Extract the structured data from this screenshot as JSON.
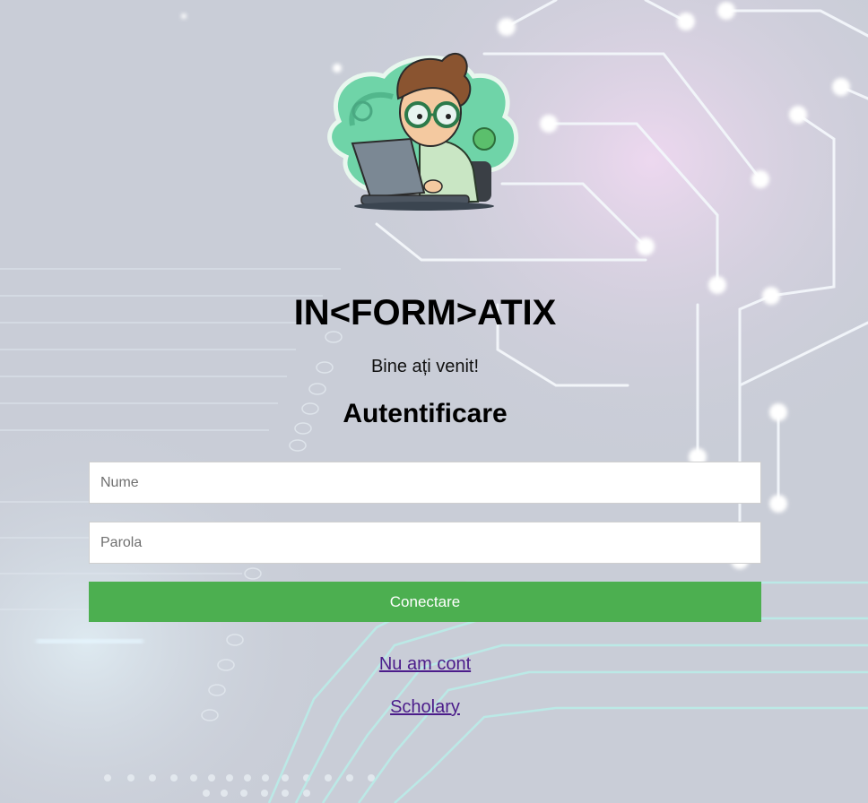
{
  "brand": {
    "title": "IN<FORM>ATIX",
    "welcome": "Bine ați venit!"
  },
  "login": {
    "heading": "Autentificare",
    "username_placeholder": "Nume",
    "password_placeholder": "Parola",
    "submit_label": "Conectare"
  },
  "links": {
    "register": "Nu am cont",
    "scholary": "Scholary"
  },
  "colors": {
    "accent": "#4caf50",
    "link": "#4b1c8a",
    "background": "#c8ccd6"
  }
}
